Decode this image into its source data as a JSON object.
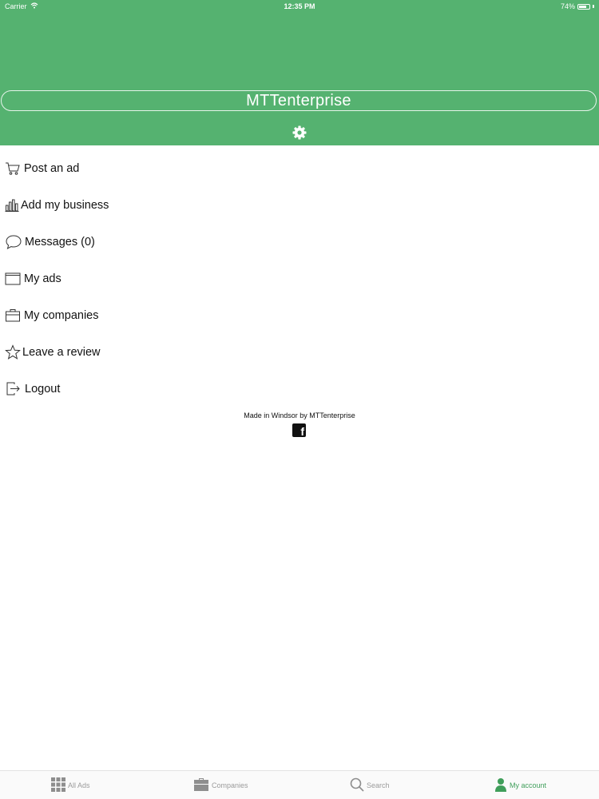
{
  "status_bar": {
    "carrier": "Carrier",
    "time": "12:35 PM",
    "battery": "74%",
    "battery_level": 0.74
  },
  "header": {
    "title": "MTTenterprise",
    "settings_icon": "gear-icon",
    "background_color": "#55b270"
  },
  "menu": {
    "items": [
      {
        "label": "Post an ad",
        "icon": "cart-icon"
      },
      {
        "label": "Add my business",
        "icon": "bar-chart-icon"
      },
      {
        "label": "Messages (0)",
        "icon": "chat-bubble-icon"
      },
      {
        "label": "My ads",
        "icon": "folder-icon"
      },
      {
        "label": "My companies",
        "icon": "briefcase-icon"
      },
      {
        "label": "Leave a review",
        "icon": "star-icon"
      },
      {
        "label": "Logout",
        "icon": "logout-icon"
      }
    ]
  },
  "footer": {
    "credit": "Made in Windsor by MTTenterprise",
    "social_icon": "facebook-icon",
    "social_letter": "f"
  },
  "tabbar": {
    "active_color": "#3f9e5a",
    "tabs": [
      {
        "label": "All Ads",
        "icon": "grid-icon",
        "active": false
      },
      {
        "label": "Companies",
        "icon": "briefcase-icon",
        "active": false
      },
      {
        "label": "Search",
        "icon": "search-icon",
        "active": false
      },
      {
        "label": "My account",
        "icon": "person-icon",
        "active": true
      }
    ]
  }
}
